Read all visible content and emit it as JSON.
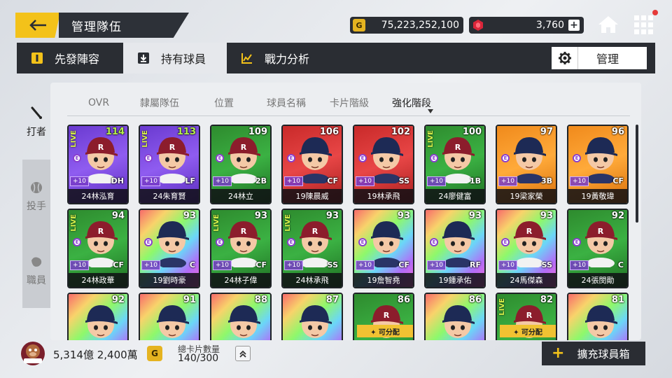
{
  "header": {
    "title": "管理隊伍",
    "gold_amount": "75,223,252,100",
    "gold_icon_label": "G",
    "gem_amount": "3,760"
  },
  "tabs": [
    {
      "label": "先發陣容"
    },
    {
      "label": "持有球員"
    },
    {
      "label": "戰力分析"
    }
  ],
  "manage_label": "管理",
  "side": {
    "batter": "打者",
    "pitcher": "投手",
    "staff": "職員"
  },
  "sort": {
    "ovr": "OVR",
    "team": "隸屬隊伍",
    "position": "位置",
    "name": "球員名稱",
    "grade": "卡片階級",
    "enhance": "強化階段"
  },
  "cards": [
    {
      "name": "24林泓育",
      "ovr": "114",
      "pos": "DH",
      "plus": "+10",
      "bg": "purple",
      "live": "LIVE",
      "team": "R",
      "ovr_green": true
    },
    {
      "name": "24朱育賢",
      "ovr": "113",
      "pos": "LF",
      "plus": "+10",
      "bg": "purple",
      "live": "LIVE",
      "team": "R",
      "ovr_green": true
    },
    {
      "name": "24林立",
      "ovr": "109",
      "pos": "2B",
      "plus": "+10",
      "bg": "green",
      "live": "",
      "team": "R",
      "ovr_green": false
    },
    {
      "name": "19陳晨威",
      "ovr": "106",
      "pos": "CF",
      "plus": "+10",
      "bg": "red",
      "live": "",
      "team": "LM",
      "ovr_green": false
    },
    {
      "name": "19林承飛",
      "ovr": "102",
      "pos": "SS",
      "plus": "+10",
      "bg": "red",
      "live": "",
      "team": "LM",
      "ovr_green": false
    },
    {
      "name": "24廖健富",
      "ovr": "100",
      "pos": "1B",
      "plus": "+10",
      "bg": "green",
      "live": "LIVE",
      "team": "R",
      "ovr_green": false
    },
    {
      "name": "19梁家榮",
      "ovr": "97",
      "pos": "3B",
      "plus": "+10",
      "bg": "orange",
      "live": "",
      "team": "LM",
      "ovr_green": false
    },
    {
      "name": "19黃敬瑋",
      "ovr": "96",
      "pos": "CF",
      "plus": "+10",
      "bg": "orange",
      "live": "",
      "team": "LM",
      "ovr_green": false
    },
    {
      "name": "24林政華",
      "ovr": "94",
      "pos": "CF",
      "plus": "+10",
      "bg": "green",
      "live": "LIVE",
      "team": "R",
      "ovr_green": false
    },
    {
      "name": "19劉時豪",
      "ovr": "93",
      "pos": "C",
      "plus": "+10",
      "bg": "rainbow",
      "live": "",
      "team": "LM",
      "ovr_green": false
    },
    {
      "name": "24林子偉",
      "ovr": "93",
      "pos": "CF",
      "plus": "+10",
      "bg": "green",
      "live": "LIVE",
      "team": "R",
      "ovr_green": false
    },
    {
      "name": "24林承飛",
      "ovr": "93",
      "pos": "SS",
      "plus": "+10",
      "bg": "green",
      "live": "LIVE",
      "team": "R",
      "ovr_green": false
    },
    {
      "name": "19詹智堯",
      "ovr": "93",
      "pos": "CF",
      "plus": "+10",
      "bg": "rainbow",
      "live": "",
      "team": "LM",
      "ovr_green": false
    },
    {
      "name": "19鍾承佑",
      "ovr": "93",
      "pos": "RF",
      "plus": "+10",
      "bg": "rainbow",
      "live": "",
      "team": "LM",
      "ovr_green": false
    },
    {
      "name": "24馬傑森",
      "ovr": "93",
      "pos": "SS",
      "plus": "+10",
      "bg": "rainbow",
      "live": "",
      "team": "R",
      "ovr_green": false
    },
    {
      "name": "24張閔勛",
      "ovr": "92",
      "pos": "C",
      "plus": "+10",
      "bg": "green",
      "live": "",
      "team": "R",
      "ovr_green": false
    },
    {
      "name": "",
      "ovr": "92",
      "pos": "",
      "plus": "",
      "bg": "rainbow",
      "live": "",
      "team": "LM",
      "ovr_green": false
    },
    {
      "name": "",
      "ovr": "91",
      "pos": "",
      "plus": "",
      "bg": "rainbow",
      "live": "",
      "team": "LM",
      "ovr_green": false
    },
    {
      "name": "",
      "ovr": "88",
      "pos": "",
      "plus": "",
      "bg": "rainbow",
      "live": "",
      "team": "LM",
      "ovr_green": false
    },
    {
      "name": "",
      "ovr": "87",
      "pos": "",
      "plus": "",
      "bg": "rainbow",
      "live": "",
      "team": "LM",
      "ovr_green": false
    },
    {
      "name": "",
      "ovr": "86",
      "pos": "",
      "plus": "",
      "bg": "green",
      "live": "",
      "team": "R",
      "ovr_green": false,
      "assign": "可分配"
    },
    {
      "name": "",
      "ovr": "86",
      "pos": "",
      "plus": "",
      "bg": "rainbow",
      "live": "",
      "team": "LM",
      "ovr_green": false
    },
    {
      "name": "",
      "ovr": "82",
      "pos": "",
      "plus": "",
      "bg": "green",
      "live": "LIVE",
      "team": "R",
      "ovr_green": false,
      "assign": "可分配"
    },
    {
      "name": "",
      "ovr": "81",
      "pos": "",
      "plus": "",
      "bg": "rainbow",
      "live": "",
      "team": "LM",
      "ovr_green": false
    }
  ],
  "bottom": {
    "money": "5,314億 2,400萬",
    "coin_label": "G",
    "card_count_label": "總卡片數量",
    "card_count_value": "140/300",
    "expand_label": "擴充球員箱"
  }
}
